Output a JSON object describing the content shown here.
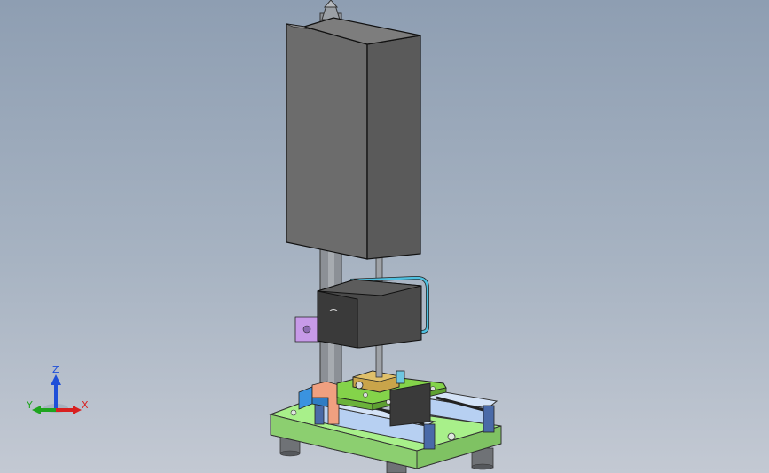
{
  "viewport": {
    "background_top": "#8e9eb2",
    "background_bottom": "#c3c9d3"
  },
  "triad": {
    "z_label": "Z",
    "x_label": "X",
    "y_label": "Y",
    "z_color": "#1f4fd8",
    "x_color": "#d82020",
    "y_color": "#1fa51f"
  },
  "model": {
    "base_color": "#a8f08a",
    "carriage_color": "#84d34a",
    "rail_color": "#b7d0f2",
    "cover_color": "#6c6c6c",
    "slider_color": "#3a3a3a",
    "block_purple": "#c79ae8",
    "block_orange": "#f0a080",
    "block_blue": "#3a93e0",
    "block_gold": "#c9a44a",
    "cable_color": "#4fc0e0"
  }
}
